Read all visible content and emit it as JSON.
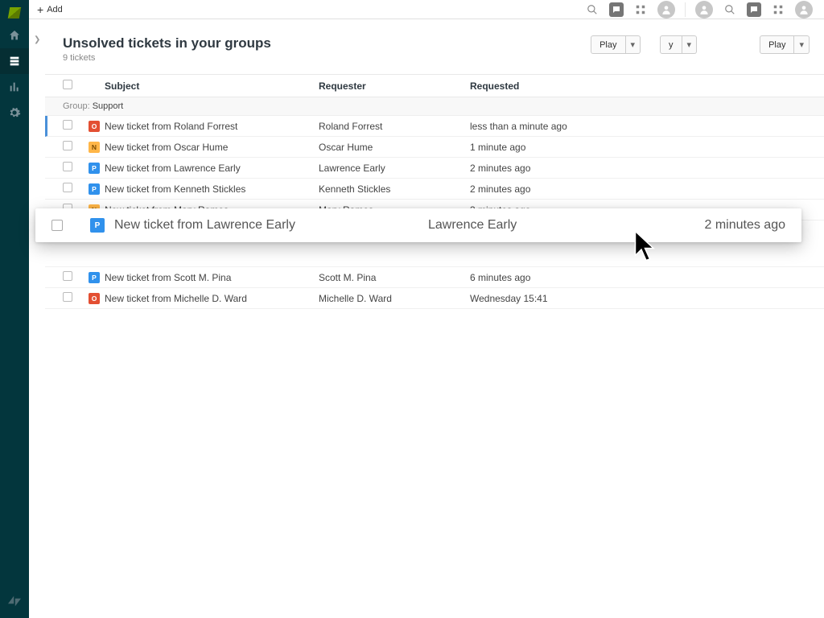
{
  "topbar": {
    "add_label": "Add"
  },
  "header": {
    "title": "Unsolved tickets in your groups",
    "count": "9 tickets",
    "play_label": "Play",
    "y_label": "y"
  },
  "columns": {
    "subject": "Subject",
    "requester": "Requester",
    "requested": "Requested"
  },
  "group": {
    "label": "Group:",
    "name": "Support"
  },
  "rows": [
    {
      "badge": "O",
      "subject": "New ticket from Roland Forrest",
      "requester": "Roland Forrest",
      "requested": "less than a minute ago",
      "first": true
    },
    {
      "badge": "N",
      "subject": "New ticket from Oscar Hume",
      "requester": "Oscar Hume",
      "requested": "1 minute ago"
    },
    {
      "badge": "P",
      "subject": "New ticket from Lawrence Early",
      "requester": "Lawrence Early",
      "requested": "2 minutes ago"
    },
    {
      "badge": "P",
      "subject": "New ticket from Kenneth Stickles",
      "requester": "Kenneth Stickles",
      "requested": "2 minutes ago"
    },
    {
      "badge": "N",
      "subject": "New ticket from Mary Ramos",
      "requester": "Mary Ramos",
      "requested": "3 minutes ago"
    }
  ],
  "rows_after": [
    {
      "badge": "P",
      "subject": "New ticket from Scott M. Pina",
      "requester": "Scott M. Pina",
      "requested": "6 minutes ago"
    },
    {
      "badge": "O",
      "subject": "New ticket from Michelle D. Ward",
      "requester": "Michelle D. Ward",
      "requested": "Wednesday 15:41"
    }
  ],
  "floating": {
    "badge": "P",
    "subject": "New ticket from Lawrence Early",
    "requester": "Lawrence Early",
    "requested": "2 minutes ago"
  }
}
